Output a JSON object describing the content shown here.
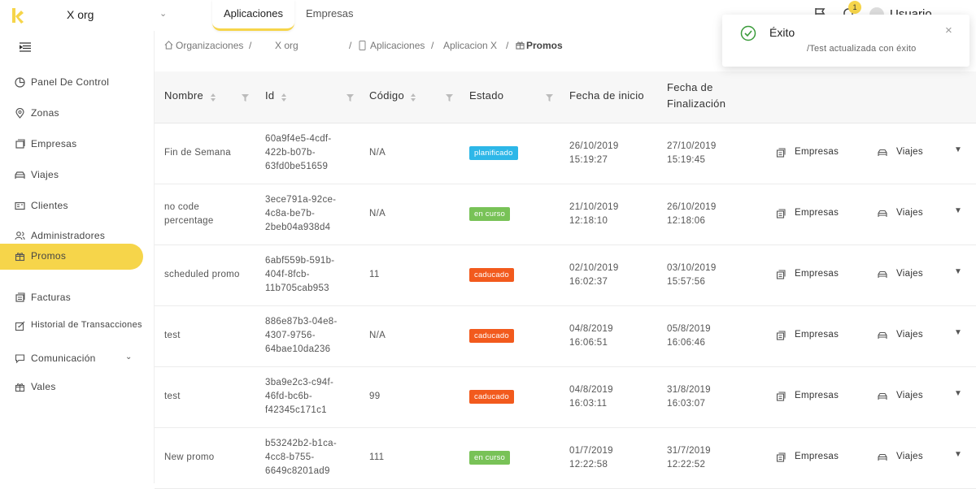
{
  "header": {
    "org_name": "X org",
    "tabs": [
      {
        "label": "Aplicaciones",
        "active": true
      },
      {
        "label": "Empresas",
        "active": false
      }
    ],
    "notification_count": "1",
    "user_name": "Usuario",
    "colors": {
      "accent": "#f6d54a"
    }
  },
  "sidebar": {
    "items": [
      {
        "label": "Panel De Control",
        "icon": "pie-chart-icon"
      },
      {
        "label": "Zonas",
        "icon": "map-pin-icon"
      },
      {
        "label": "Empresas",
        "icon": "building-icon"
      },
      {
        "label": "Viajes",
        "icon": "car-icon"
      },
      {
        "label": "Clientes",
        "icon": "id-card-icon"
      },
      {
        "label": "Administradores",
        "icon": "users-icon"
      },
      {
        "label": "Promos",
        "icon": "gift-icon",
        "active": true
      },
      {
        "label": "Facturas",
        "icon": "invoice-icon"
      },
      {
        "label": "Historial de Transacciones",
        "icon": "edit-icon"
      },
      {
        "label": "Comunicación",
        "icon": "chat-icon",
        "has_children": true
      },
      {
        "label": "Vales",
        "icon": "gift-icon"
      }
    ]
  },
  "breadcrumb": {
    "items": [
      "Organizaciones",
      "X org",
      "Aplicaciones",
      "Aplicacion X",
      "Promos"
    ],
    "separator": "/"
  },
  "table": {
    "columns": [
      "Nombre",
      "Id",
      "Código",
      "Estado",
      "Fecha de inicio",
      "Fecha de Finalización"
    ],
    "action_empresas": "Empresas",
    "action_viajes": "Viajes",
    "rows": [
      {
        "name": "Fin de Semana",
        "id": "60a9f4e5-4cdf-422b-b07b-63fd0be51659",
        "id_lines": [
          "60a9f4e5-4cdf-",
          "422b-b07b-",
          "63fd0be51659"
        ],
        "code": "N/A",
        "status": "planificado",
        "status_color": "#2db7e8",
        "start": [
          "26/10/2019",
          "15:19:27"
        ],
        "end": [
          "27/10/2019",
          "15:19:45"
        ]
      },
      {
        "name": "no code percentage",
        "name_lines": [
          "no code",
          "percentage"
        ],
        "id_lines": [
          "3ece791a-92ce-",
          "4c8a-be7b-",
          "2beb04a938d4"
        ],
        "code": "N/A",
        "status": "en curso",
        "status_color": "#78c257",
        "start": [
          "21/10/2019",
          "12:18:10"
        ],
        "end": [
          "26/10/2019",
          "12:18:06"
        ]
      },
      {
        "name": "scheduled promo",
        "id_lines": [
          "6abf559b-591b-",
          "404f-8fcb-",
          "11b705cab953"
        ],
        "code": "11",
        "status": "caducado",
        "status_color": "#f25a1d",
        "start": [
          "02/10/2019",
          "16:02:37"
        ],
        "end": [
          "03/10/2019",
          "15:57:56"
        ]
      },
      {
        "name": "test",
        "id_lines": [
          "886e87b3-04e8-",
          "4307-9756-",
          "64bae10da236"
        ],
        "code": "N/A",
        "status": "caducado",
        "status_color": "#f25a1d",
        "start": [
          "04/8/2019",
          "16:06:51"
        ],
        "end": [
          "05/8/2019",
          "16:06:46"
        ]
      },
      {
        "name": "test",
        "id_lines": [
          "3ba9e2c3-c94f-",
          "46fd-bc6b-",
          "f42345c171c1"
        ],
        "code": "99",
        "status": "caducado",
        "status_color": "#f25a1d",
        "start": [
          "04/8/2019",
          "16:03:11"
        ],
        "end": [
          "31/8/2019",
          "16:03:07"
        ]
      },
      {
        "name": "New promo",
        "id_lines": [
          "b53242b2-b1ca-",
          "4cc8-b755-",
          "6649c8201ad9"
        ],
        "code": "111",
        "status": "en curso",
        "status_color": "#78c257",
        "start": [
          "01/7/2019",
          "12:22:58"
        ],
        "end": [
          "31/7/2019",
          "12:22:52"
        ]
      }
    ]
  },
  "toast": {
    "title": "Éxito",
    "message": "/Test actualizada con éxito",
    "icon": "check-circle-icon"
  }
}
